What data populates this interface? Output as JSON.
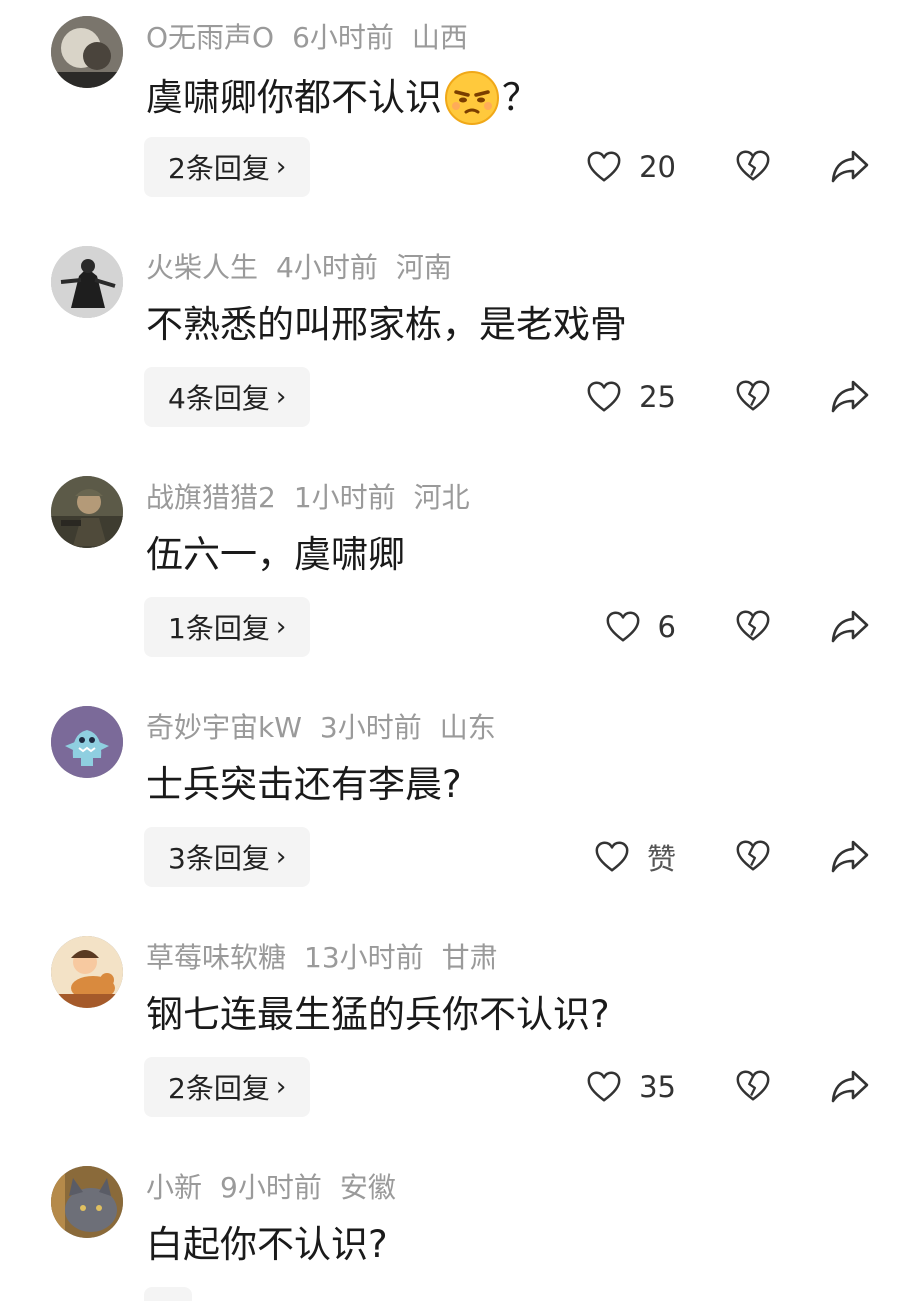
{
  "comments": [
    {
      "user": "O无雨声O",
      "time": "6小时前",
      "region": "山西",
      "text_before": "虞啸卿你都不认识",
      "emoji": "annoyed-face-emoji",
      "text_after": "？",
      "replies": "2条回复",
      "likes": "20"
    },
    {
      "user": "火柴人生",
      "time": "4小时前",
      "region": "河南",
      "text_before": "不熟悉的叫邢家栋，是老戏骨",
      "text_after": "",
      "replies": "4条回复",
      "likes": "25"
    },
    {
      "user": "战旗猎猎2",
      "time": "1小时前",
      "region": "河北",
      "text_before": "伍六一，虞啸卿",
      "text_after": "",
      "replies": "1条回复",
      "likes": "6"
    },
    {
      "user": "奇妙宇宙kW",
      "time": "3小时前",
      "region": "山东",
      "text_before": "士兵突击还有李晨?",
      "text_after": "",
      "replies": "3条回复",
      "likes": "赞"
    },
    {
      "user": "草莓味软糖",
      "time": "13小时前",
      "region": "甘肃",
      "text_before": "钢七连最生猛的兵你不认识?",
      "text_after": "",
      "replies": "2条回复",
      "likes": "35"
    },
    {
      "user": "小新",
      "time": "9小时前",
      "region": "安徽",
      "text_before": "白起你不认识?",
      "text_after": "",
      "replies": "",
      "likes": ""
    }
  ],
  "icons": {
    "like": "heart-icon",
    "dislike": "broken-heart-icon",
    "share": "share-arrow-icon",
    "chevron": "chevron-right-icon"
  },
  "colors": {
    "meta": "#9a9a9a",
    "text": "#1a1a1a",
    "button_bg": "#f4f4f4"
  }
}
